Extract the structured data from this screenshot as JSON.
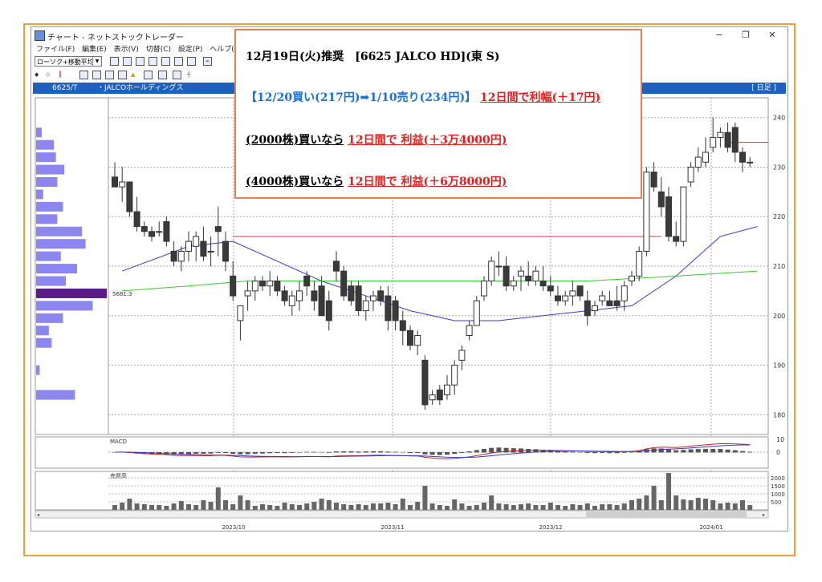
{
  "window": {
    "title": "チャート - ネットストックトレーダー",
    "minimize": "−",
    "restore": "❐",
    "close": "✕"
  },
  "menu": [
    "ファイル(F)",
    "編集(E)",
    "表示(V)",
    "切替(C)",
    "設定(P)",
    "ヘルプ(H)"
  ],
  "toolbar": {
    "indicator_select": "ローソク+移動平均",
    "icons": [
      "chart-icon",
      "chart-icon",
      "chart-icon",
      "chart-icon",
      "chart-icon",
      "chart-icon",
      "chart-icon",
      "link-icon"
    ],
    "drawing_icons": [
      "ha-icon",
      "bb-icon",
      "mf-icon",
      "log-icon",
      "warning-icon",
      "print-icon",
      "zoom-icon",
      "grid-icon",
      "cross-icon"
    ]
  },
  "infobar": {
    "code": "6625/T",
    "name": "・JALCOホールディングス",
    "freq": "[ 日足 ]"
  },
  "chart_data": {
    "type": "candlestick",
    "y_ticks": [
      180,
      190,
      200,
      210,
      220,
      230,
      240
    ],
    "y_range": [
      176,
      244
    ],
    "x_ticks": [
      "2023/10",
      "2023/11",
      "2023/12",
      "2024/01"
    ],
    "volume_profile_label": "5681.3",
    "volume_profile_levels": [
      {
        "price": 237.0,
        "size": 0.08
      },
      {
        "price": 234.5,
        "size": 0.25
      },
      {
        "price": 232.0,
        "size": 0.28
      },
      {
        "price": 229.5,
        "size": 0.4
      },
      {
        "price": 227.0,
        "size": 0.3
      },
      {
        "price": 224.5,
        "size": 0.1
      },
      {
        "price": 222.0,
        "size": 0.38
      },
      {
        "price": 219.5,
        "size": 0.3
      },
      {
        "price": 217.0,
        "size": 0.65
      },
      {
        "price": 214.5,
        "size": 0.7
      },
      {
        "price": 212.0,
        "size": 0.35
      },
      {
        "price": 209.5,
        "size": 0.58
      },
      {
        "price": 207.0,
        "size": 0.42
      },
      {
        "price": 204.5,
        "size": 1.0
      },
      {
        "price": 202.0,
        "size": 0.8
      },
      {
        "price": 199.5,
        "size": 0.38
      },
      {
        "price": 197.0,
        "size": 0.18
      },
      {
        "price": 194.5,
        "size": 0.22
      },
      {
        "price": 189.0,
        "size": 0.05
      },
      {
        "price": 184.0,
        "size": 0.55
      }
    ],
    "reference_line": 216,
    "reference_line_2": 235,
    "candles": [
      [
        228,
        231,
        226,
        226
      ],
      [
        226,
        230,
        223,
        227
      ],
      [
        227,
        226,
        220,
        221
      ],
      [
        221,
        224,
        217,
        218
      ],
      [
        218,
        219,
        216,
        217
      ],
      [
        217,
        218,
        215,
        216
      ],
      [
        217,
        219,
        216,
        217
      ],
      [
        219,
        220,
        214,
        215
      ],
      [
        213,
        215,
        210,
        211
      ],
      [
        211,
        214,
        209,
        213
      ],
      [
        213,
        217,
        211,
        215
      ],
      [
        214,
        217,
        211,
        216
      ],
      [
        215,
        218,
        211,
        212
      ],
      [
        213,
        216,
        210,
        213
      ],
      [
        218,
        222,
        212,
        217
      ],
      [
        215,
        217,
        209,
        211
      ],
      [
        208,
        211,
        203,
        204
      ],
      [
        199,
        202,
        195,
        202
      ],
      [
        204,
        207,
        201,
        205
      ],
      [
        205,
        208,
        203,
        207
      ],
      [
        207,
        208,
        205,
        206
      ],
      [
        206,
        209,
        204,
        207
      ],
      [
        207,
        208,
        204,
        205
      ],
      [
        205,
        206,
        202,
        203
      ],
      [
        202,
        205,
        200,
        204
      ],
      [
        203,
        207,
        201,
        205
      ],
      [
        208,
        209,
        204,
        206
      ],
      [
        205,
        207,
        201,
        203
      ],
      [
        206,
        208,
        200,
        200
      ],
      [
        203,
        205,
        197,
        199
      ],
      [
        211,
        213,
        207,
        209
      ],
      [
        209,
        210,
        203,
        204
      ],
      [
        206,
        207,
        202,
        203
      ],
      [
        206,
        207,
        200,
        201
      ],
      [
        201,
        204,
        199,
        203
      ],
      [
        203,
        205,
        201,
        204
      ],
      [
        205,
        206,
        202,
        203
      ],
      [
        204,
        206,
        197,
        199
      ],
      [
        203,
        204,
        197,
        199
      ],
      [
        199,
        201,
        194,
        197
      ],
      [
        197,
        198,
        193,
        194
      ],
      [
        194,
        197,
        192,
        196
      ],
      [
        191,
        192,
        181,
        182
      ],
      [
        183,
        185,
        182,
        184
      ],
      [
        185,
        186,
        182,
        183
      ],
      [
        184,
        188,
        183,
        186
      ],
      [
        186,
        191,
        184,
        190
      ],
      [
        191,
        194,
        189,
        193
      ],
      [
        196,
        199,
        195,
        198
      ],
      [
        198,
        204,
        198,
        203
      ],
      [
        204,
        208,
        203,
        207
      ],
      [
        207,
        212,
        206,
        211
      ],
      [
        210,
        213,
        208,
        210
      ],
      [
        210,
        212,
        205,
        206
      ],
      [
        206,
        208,
        205,
        207
      ],
      [
        208,
        210,
        205,
        209
      ],
      [
        208,
        211,
        206,
        207
      ],
      [
        207,
        210,
        206,
        209
      ],
      [
        207,
        210,
        205,
        206
      ],
      [
        206,
        208,
        204,
        205
      ],
      [
        204,
        206,
        202,
        203
      ],
      [
        203,
        205,
        202,
        204
      ],
      [
        204,
        207,
        202,
        205
      ],
      [
        206,
        206,
        203,
        204
      ],
      [
        203,
        205,
        198,
        200
      ],
      [
        201,
        203,
        200,
        202
      ],
      [
        203,
        205,
        202,
        204
      ],
      [
        203,
        205,
        202,
        202
      ],
      [
        203,
        206,
        201,
        202
      ],
      [
        203,
        207,
        201,
        206
      ],
      [
        207,
        209,
        206,
        208
      ],
      [
        208,
        214,
        207,
        213
      ],
      [
        213,
        230,
        212,
        229
      ],
      [
        229,
        231,
        225,
        226
      ],
      [
        225,
        228,
        220,
        222
      ],
      [
        224,
        226,
        215,
        216
      ],
      [
        216,
        219,
        214,
        215
      ],
      [
        215,
        226,
        214,
        226
      ],
      [
        227,
        231,
        226,
        230
      ],
      [
        230,
        234,
        229,
        232
      ],
      [
        231,
        236,
        230,
        233
      ],
      [
        234,
        240,
        233,
        236
      ],
      [
        236,
        238,
        234,
        237
      ],
      [
        237,
        239,
        233,
        234
      ],
      [
        238,
        239,
        231,
        233
      ],
      [
        233,
        234,
        229,
        231
      ],
      [
        231,
        232,
        230,
        231
      ]
    ],
    "ma_short": [
      [
        1,
        209
      ],
      [
        10,
        214
      ],
      [
        16,
        215
      ],
      [
        22,
        211
      ],
      [
        28,
        207
      ],
      [
        34,
        204
      ],
      [
        40,
        201
      ],
      [
        46,
        199
      ],
      [
        52,
        199
      ],
      [
        58,
        200
      ],
      [
        64,
        201
      ],
      [
        70,
        202
      ],
      [
        76,
        208
      ],
      [
        82,
        216
      ],
      [
        87,
        218
      ]
    ],
    "ma_long": [
      [
        1,
        205
      ],
      [
        10,
        206
      ],
      [
        18,
        207
      ],
      [
        28,
        207
      ],
      [
        40,
        207
      ],
      [
        52,
        207
      ],
      [
        64,
        207
      ],
      [
        76,
        208
      ],
      [
        87,
        209
      ]
    ],
    "macd": {
      "label": "MACD",
      "y_ticks": [
        10,
        0
      ]
    },
    "volume": {
      "label": "売買高",
      "y_ticks": [
        2000,
        1500,
        1000,
        500
      ],
      "y_range": [
        0,
        2400
      ],
      "values": [
        300,
        450,
        700,
        400,
        350,
        300,
        300,
        250,
        400,
        550,
        350,
        300,
        600,
        500,
        1400,
        600,
        350,
        900,
        600,
        250,
        350,
        300,
        250,
        450,
        350,
        300,
        400,
        500,
        700,
        600,
        450,
        350,
        300,
        350,
        300,
        400,
        400,
        450,
        350,
        700,
        300,
        500,
        1500,
        400,
        300,
        250,
        650,
        400,
        250,
        300,
        450,
        900,
        400,
        350,
        300,
        350,
        400,
        300,
        300,
        450,
        300,
        250,
        350,
        300,
        400,
        250,
        350,
        350,
        300,
        400,
        600,
        700,
        900,
        1500,
        600,
        2300,
        900,
        650,
        600,
        750,
        700,
        600,
        400,
        450,
        400,
        600,
        300
      ]
    }
  },
  "popup": {
    "line1": "12月19日(火)推奨　[6625 JALCO HD](東 S)",
    "line2_a": "【12/20買い(217円)➡1/10売り(234円)】",
    "line2_b": "12日間で利幅(＋17円)",
    "line3_a": "(2000株)買いなら",
    "line3_b": "12日間で 利益(＋3万4000円)",
    "line4_a": "(4000株)買いなら",
    "line4_b": "12日間で 利益(＋6万8000円)"
  },
  "colors": {
    "up": "#ffffff",
    "down": "#3a3a3a",
    "ma_short": "#3a3ad0",
    "ma_long": "#33cc33",
    "ref_line": "#e03030",
    "profile": "#8c86f0",
    "profile_hl": "#5a1a8a",
    "infobar": "#1f5fbf",
    "popup_border": "#e8804a",
    "frame_border": "#f0a030"
  }
}
